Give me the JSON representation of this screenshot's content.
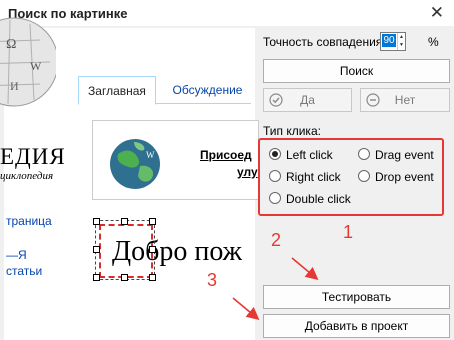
{
  "window": {
    "title": "Поиск по картинке",
    "close_glyph": "✕"
  },
  "preview": {
    "logo_text": "ЕДИЯ",
    "logo_sub": "циклопедия",
    "side_links": [
      "траница",
      "—Я",
      "статьи"
    ],
    "tabs": [
      "Заглавная",
      "Обсуждение"
    ],
    "promo_line1": "Присоед",
    "promo_line2": "улу",
    "big_text": "Добро пож"
  },
  "settings": {
    "accuracy_label": "Точность совпадения:",
    "accuracy_value": "90",
    "accuracy_unit": "%",
    "search_button": "Поиск",
    "yes_button": "Да",
    "no_button": "Нет",
    "click_type_label": "Тип клика:",
    "click_options": [
      "Left click",
      "Drag event",
      "Right click",
      "Drop event",
      "Double click"
    ],
    "selected_option": "Left click",
    "test_button": "Тестировать",
    "add_button": "Добавить в проект"
  },
  "annotations": {
    "n1": "1",
    "n2": "2",
    "n3": "3"
  },
  "colors": {
    "annotation": "#e53935",
    "link": "#0645ad",
    "selection": "#0078d7"
  }
}
